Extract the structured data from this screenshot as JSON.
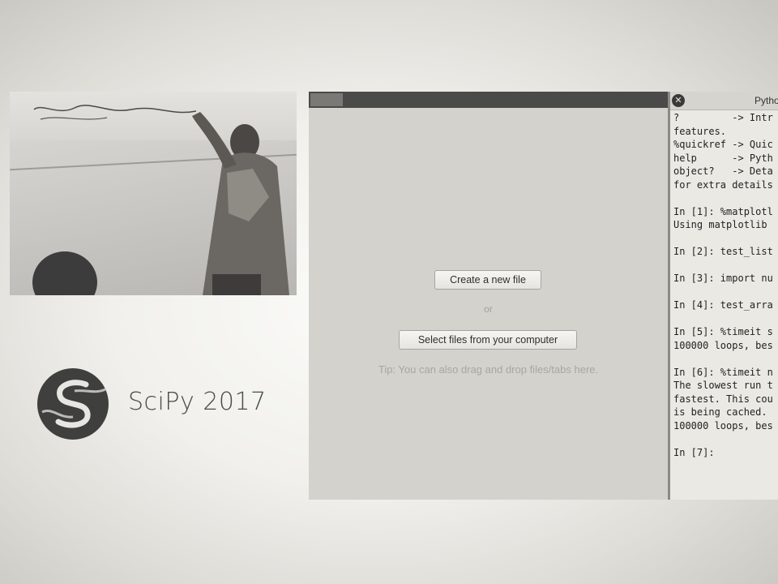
{
  "logo": {
    "text": "SciPy 2017"
  },
  "editor": {
    "create_label": "Create a new file",
    "or_label": "or",
    "select_label": "Select files from your computer",
    "tip": "Tip: You can also drag and drop files/tabs here."
  },
  "console": {
    "title": "Pytho",
    "close_glyph": "✕",
    "lines": [
      "?         -> Intr",
      "features.",
      "%quickref -> Quic",
      "help      -> Pyth",
      "object?   -> Deta",
      "for extra details",
      "",
      "In [1]: %matplotl",
      "Using matplotlib",
      "",
      "In [2]: test_list",
      "",
      "In [3]: import nu",
      "",
      "In [4]: test_arra",
      "",
      "In [5]: %timeit s",
      "100000 loops, bes",
      "",
      "In [6]: %timeit n",
      "The slowest run t",
      "fastest. This cou",
      "is being cached.",
      "100000 loops, bes",
      "",
      "In [7]:"
    ]
  }
}
